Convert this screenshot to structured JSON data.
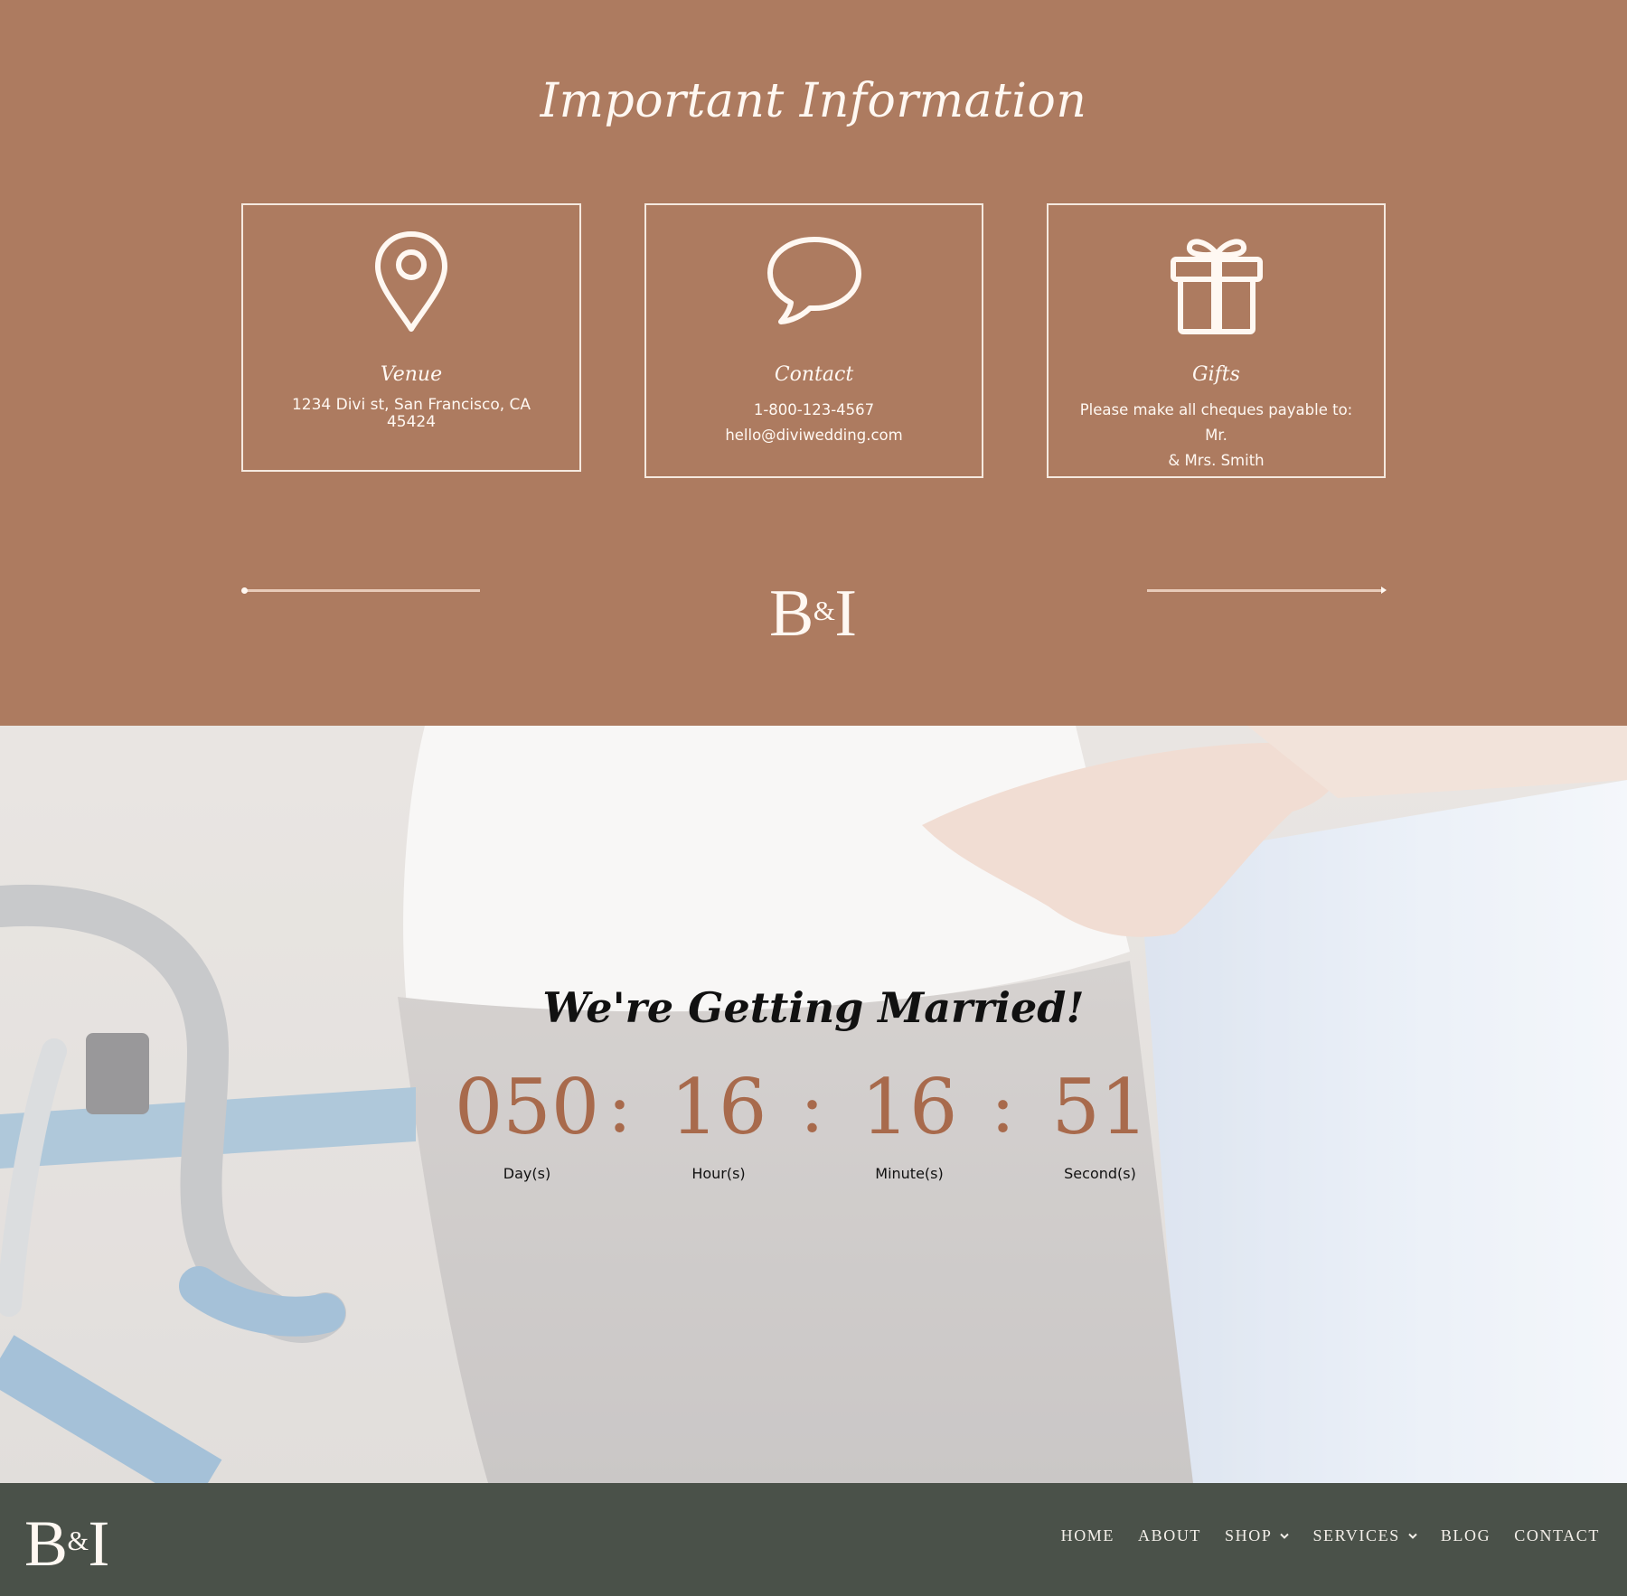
{
  "info": {
    "title": "Important Information",
    "cards": [
      {
        "icon": "map-pin-icon",
        "title": "Venue",
        "lines": [
          "1234 Divi st, San Francisco, CA",
          "45424"
        ]
      },
      {
        "icon": "speech-bubble-icon",
        "title": "Contact",
        "lines": [
          "1-800-123-4567",
          "hello@diviwedding.com"
        ]
      },
      {
        "icon": "gift-icon",
        "title": "Gifts",
        "lines": [
          "Please make all cheques payable to: Mr.",
          "& Mrs. Smith"
        ]
      }
    ],
    "monogram": {
      "left": "B",
      "amp": "&",
      "right": "I"
    }
  },
  "countdown": {
    "heading": "We're Getting Married!",
    "separator": ":",
    "units": [
      {
        "value": "050",
        "label": "Day(s)"
      },
      {
        "value": "16",
        "label": "Hour(s)"
      },
      {
        "value": "16",
        "label": "Minute(s)"
      },
      {
        "value": "51",
        "label": "Second(s)"
      }
    ]
  },
  "footer": {
    "logo": {
      "left": "B",
      "amp": "&",
      "right": "I"
    },
    "nav": [
      {
        "label": "HOME",
        "has_dropdown": false
      },
      {
        "label": "ABOUT",
        "has_dropdown": false
      },
      {
        "label": "SHOP",
        "has_dropdown": true
      },
      {
        "label": "SERVICES",
        "has_dropdown": true
      },
      {
        "label": "BLOG",
        "has_dropdown": false
      },
      {
        "label": "CONTACT",
        "has_dropdown": false
      }
    ]
  },
  "colors": {
    "info_bg": "#ad7b60",
    "accent": "#a86a4c",
    "footer_bg": "#4a5149",
    "text_light": "#fff8f2"
  }
}
